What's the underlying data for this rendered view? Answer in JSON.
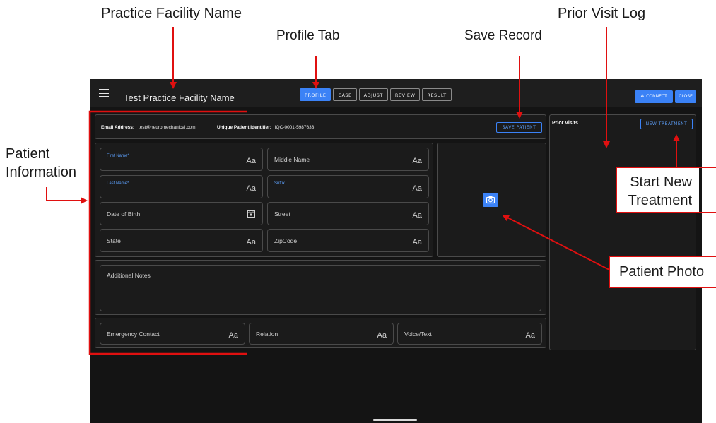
{
  "annotations": {
    "facility_name": "Practice Facility  Name",
    "profile_tab": "Profile Tab",
    "save_record": "Save Record",
    "prior_visit_log": "Prior Visit Log",
    "patient_info_1": "Patient",
    "patient_info_2": "Information",
    "start_new_1": "Start New",
    "start_new_2": "Treatment",
    "patient_photo": "Patient Photo"
  },
  "appbar": {
    "title": "Test Practice Facility Name",
    "tabs": [
      "PROFILE",
      "CASE",
      "ADJUST",
      "REVIEW",
      "RESULT"
    ],
    "active_tab": "PROFILE",
    "connect": "CONNECT",
    "close": "CLOSE"
  },
  "record": {
    "email_label": "Email Address:",
    "email_value": "test@neuromechanical.com",
    "id_label": "Unique Patient Identifier:",
    "id_value": "IQC-0001-5987633",
    "save_label": "SAVE PATIENT"
  },
  "form": {
    "first_name": "First Name*",
    "middle_name": "Middle Name",
    "last_name": "Last Name*",
    "suffix": "Suffix",
    "dob": "Date of Birth",
    "street": "Street",
    "state": "State",
    "zipcode": "ZipCode",
    "notes": "Additional Notes",
    "emergency_contact": "Emergency Contact",
    "relation": "Relation",
    "voice_text": "Voice/Text",
    "aa": "Aa"
  },
  "prior_visits": {
    "title": "Prior Visits",
    "new_treatment": "NEW TREATMENT"
  },
  "colors": {
    "accent": "#3b82f6",
    "callout_red": "#e01010",
    "screen_bg": "#141414"
  }
}
